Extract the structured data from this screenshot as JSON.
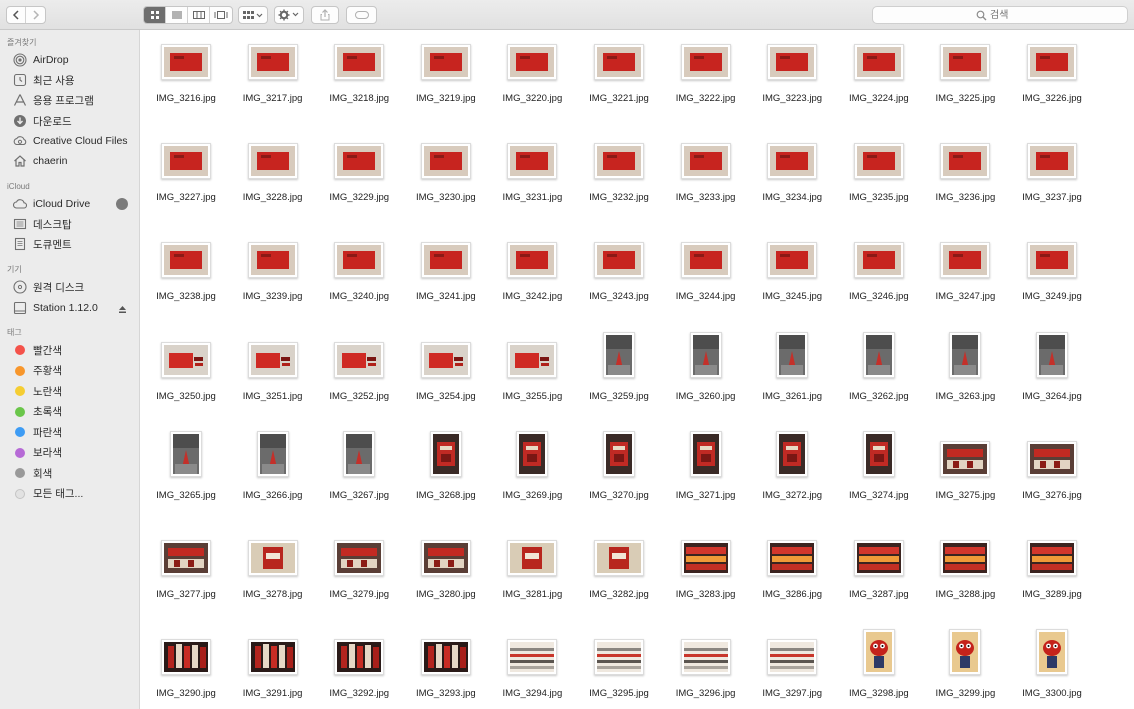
{
  "toolbar": {
    "back_icon": "chevron-left-icon",
    "forward_icon": "chevron-right-icon",
    "views": [
      "icon-view",
      "list-view",
      "column-view",
      "gallery-view"
    ],
    "selected_view": "icon-view",
    "search_placeholder": "검색"
  },
  "sidebar": {
    "favorites_title": "즐겨찾기",
    "favorites": [
      {
        "label": "AirDrop",
        "icon": "airdrop-icon"
      },
      {
        "label": "최근 사용",
        "icon": "clock-icon"
      },
      {
        "label": "응용 프로그램",
        "icon": "applications-icon"
      },
      {
        "label": "다운로드",
        "icon": "download-icon"
      },
      {
        "label": "Creative Cloud Files",
        "icon": "creative-cloud-icon"
      },
      {
        "label": "chaerin",
        "icon": "home-icon"
      }
    ],
    "icloud_title": "iCloud",
    "icloud": [
      {
        "label": "iCloud Drive",
        "icon": "cloud-icon"
      },
      {
        "label": "데스크탑",
        "icon": "desktop-icon"
      },
      {
        "label": "도큐멘트",
        "icon": "document-icon"
      }
    ],
    "devices_title": "기기",
    "devices": [
      {
        "label": "원격 디스크",
        "icon": "disc-icon"
      },
      {
        "label": "Station 1.12.0",
        "icon": "drive-icon"
      }
    ],
    "tags_title": "태그",
    "tags": [
      {
        "label": "빨간색",
        "color": "#f4524a"
      },
      {
        "label": "주황색",
        "color": "#f7962b"
      },
      {
        "label": "노란색",
        "color": "#f5cd32"
      },
      {
        "label": "초록색",
        "color": "#6ac64a"
      },
      {
        "label": "파란색",
        "color": "#3e9cf4"
      },
      {
        "label": "보라색",
        "color": "#b66ad6"
      },
      {
        "label": "회색",
        "color": "#999999"
      },
      {
        "label": "모든 태그...",
        "color": "#e2e2e2"
      }
    ]
  },
  "files": [
    {
      "name": "IMG_3216.jpg",
      "kind": "pouch"
    },
    {
      "name": "IMG_3217.jpg",
      "kind": "pouch"
    },
    {
      "name": "IMG_3218.jpg",
      "kind": "pouch"
    },
    {
      "name": "IMG_3219.jpg",
      "kind": "pouch"
    },
    {
      "name": "IMG_3220.jpg",
      "kind": "pouch"
    },
    {
      "name": "IMG_3221.jpg",
      "kind": "pouch"
    },
    {
      "name": "IMG_3222.jpg",
      "kind": "pouch"
    },
    {
      "name": "IMG_3223.jpg",
      "kind": "pouch"
    },
    {
      "name": "IMG_3224.jpg",
      "kind": "pouch"
    },
    {
      "name": "IMG_3225.jpg",
      "kind": "pouch"
    },
    {
      "name": "IMG_3226.jpg",
      "kind": "pouch"
    },
    {
      "name": "IMG_3227.jpg",
      "kind": "pouch"
    },
    {
      "name": "IMG_3228.jpg",
      "kind": "pouch"
    },
    {
      "name": "IMG_3229.jpg",
      "kind": "pouch"
    },
    {
      "name": "IMG_3230.jpg",
      "kind": "pouch"
    },
    {
      "name": "IMG_3231.jpg",
      "kind": "pouch"
    },
    {
      "name": "IMG_3232.jpg",
      "kind": "pouch"
    },
    {
      "name": "IMG_3233.jpg",
      "kind": "pouch"
    },
    {
      "name": "IMG_3234.jpg",
      "kind": "pouch"
    },
    {
      "name": "IMG_3235.jpg",
      "kind": "pouch"
    },
    {
      "name": "IMG_3236.jpg",
      "kind": "pouch"
    },
    {
      "name": "IMG_3237.jpg",
      "kind": "pouch"
    },
    {
      "name": "IMG_3238.jpg",
      "kind": "pouch"
    },
    {
      "name": "IMG_3239.jpg",
      "kind": "pouch"
    },
    {
      "name": "IMG_3240.jpg",
      "kind": "pouch"
    },
    {
      "name": "IMG_3241.jpg",
      "kind": "pouch"
    },
    {
      "name": "IMG_3242.jpg",
      "kind": "pouch"
    },
    {
      "name": "IMG_3243.jpg",
      "kind": "pouch"
    },
    {
      "name": "IMG_3244.jpg",
      "kind": "pouch"
    },
    {
      "name": "IMG_3245.jpg",
      "kind": "pouch"
    },
    {
      "name": "IMG_3246.jpg",
      "kind": "pouch"
    },
    {
      "name": "IMG_3247.jpg",
      "kind": "pouch"
    },
    {
      "name": "IMG_3249.jpg",
      "kind": "pouch"
    },
    {
      "name": "IMG_3250.jpg",
      "kind": "pouch2"
    },
    {
      "name": "IMG_3251.jpg",
      "kind": "pouch2"
    },
    {
      "name": "IMG_3252.jpg",
      "kind": "pouch2"
    },
    {
      "name": "IMG_3254.jpg",
      "kind": "pouch2"
    },
    {
      "name": "IMG_3255.jpg",
      "kind": "pouch2"
    },
    {
      "name": "IMG_3259.jpg",
      "kind": "street"
    },
    {
      "name": "IMG_3260.jpg",
      "kind": "street"
    },
    {
      "name": "IMG_3261.jpg",
      "kind": "street"
    },
    {
      "name": "IMG_3262.jpg",
      "kind": "street"
    },
    {
      "name": "IMG_3263.jpg",
      "kind": "street"
    },
    {
      "name": "IMG_3264.jpg",
      "kind": "street"
    },
    {
      "name": "IMG_3265.jpg",
      "kind": "street"
    },
    {
      "name": "IMG_3266.jpg",
      "kind": "street"
    },
    {
      "name": "IMG_3267.jpg",
      "kind": "street"
    },
    {
      "name": "IMG_3268.jpg",
      "kind": "store"
    },
    {
      "name": "IMG_3269.jpg",
      "kind": "store"
    },
    {
      "name": "IMG_3270.jpg",
      "kind": "store"
    },
    {
      "name": "IMG_3271.jpg",
      "kind": "store"
    },
    {
      "name": "IMG_3272.jpg",
      "kind": "store"
    },
    {
      "name": "IMG_3274.jpg",
      "kind": "store"
    },
    {
      "name": "IMG_3275.jpg",
      "kind": "shelf"
    },
    {
      "name": "IMG_3276.jpg",
      "kind": "shelf"
    },
    {
      "name": "IMG_3277.jpg",
      "kind": "shelf"
    },
    {
      "name": "IMG_3278.jpg",
      "kind": "beige"
    },
    {
      "name": "IMG_3279.jpg",
      "kind": "shelf"
    },
    {
      "name": "IMG_3280.jpg",
      "kind": "shelf"
    },
    {
      "name": "IMG_3281.jpg",
      "kind": "beige"
    },
    {
      "name": "IMG_3282.jpg",
      "kind": "beige"
    },
    {
      "name": "IMG_3283.jpg",
      "kind": "lipsticks"
    },
    {
      "name": "IMG_3286.jpg",
      "kind": "lipsticks"
    },
    {
      "name": "IMG_3287.jpg",
      "kind": "lipsticks"
    },
    {
      "name": "IMG_3288.jpg",
      "kind": "lipsticks"
    },
    {
      "name": "IMG_3289.jpg",
      "kind": "lipsticks"
    },
    {
      "name": "IMG_3290.jpg",
      "kind": "closeup"
    },
    {
      "name": "IMG_3291.jpg",
      "kind": "closeup"
    },
    {
      "name": "IMG_3292.jpg",
      "kind": "closeup"
    },
    {
      "name": "IMG_3293.jpg",
      "kind": "closeup"
    },
    {
      "name": "IMG_3294.jpg",
      "kind": "stripes"
    },
    {
      "name": "IMG_3295.jpg",
      "kind": "stripes"
    },
    {
      "name": "IMG_3296.jpg",
      "kind": "stripes"
    },
    {
      "name": "IMG_3297.jpg",
      "kind": "stripes"
    },
    {
      "name": "IMG_3298.jpg",
      "kind": "mascot"
    },
    {
      "name": "IMG_3299.jpg",
      "kind": "mascot"
    },
    {
      "name": "IMG_3300.jpg",
      "kind": "mascot"
    }
  ]
}
